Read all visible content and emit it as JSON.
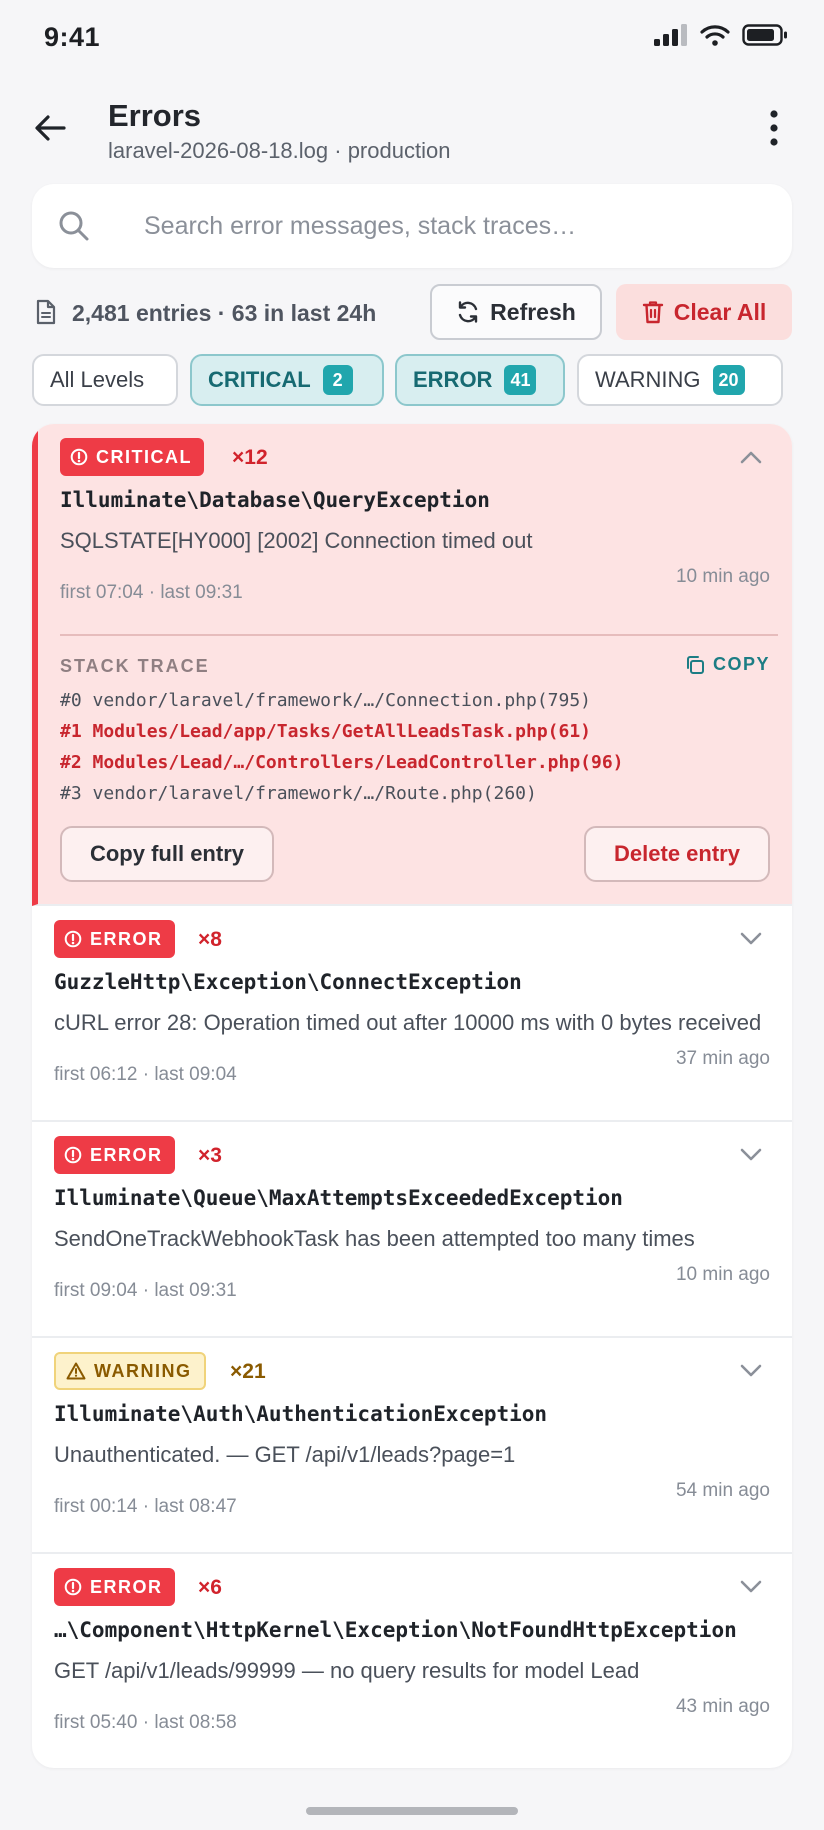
{
  "status_bar": {
    "time": "9:41"
  },
  "header": {
    "title": "Errors",
    "subtitle": "laravel-2026-08-18.log · production"
  },
  "search": {
    "placeholder": "Search error messages, stack traces…"
  },
  "toolbar": {
    "entries_text": "2,481 entries · 63 in last 24h",
    "refresh_label": "Refresh",
    "clear_label": "Clear All"
  },
  "filters": [
    {
      "label": "All Levels",
      "count": "",
      "active": false
    },
    {
      "label": "CRITICAL",
      "count": "2",
      "active": true
    },
    {
      "label": "ERROR",
      "count": "41",
      "active": true
    },
    {
      "label": "WARNING",
      "count": "20",
      "active": false
    }
  ],
  "entries": [
    {
      "level": "CRITICAL",
      "count": "×12",
      "exception": "Illuminate\\Database\\QueryException",
      "message": "SQLSTATE[HY000] [2002] Connection timed out",
      "first_last": "first 07:04  ·  last 09:31",
      "ago": "10 min ago",
      "expanded": true,
      "stack_label": "STACK TRACE",
      "copy_label": "COPY",
      "frames": [
        {
          "text": "#0 vendor/laravel/framework/…/Connection.php(795)",
          "highlight": false
        },
        {
          "text": "#1 Modules/Lead/app/Tasks/GetAllLeadsTask.php(61)",
          "highlight": true
        },
        {
          "text": "#2 Modules/Lead/…/Controllers/LeadController.php(96)",
          "highlight": true
        },
        {
          "text": "#3 vendor/laravel/framework/…/Route.php(260)",
          "highlight": false
        }
      ],
      "copy_full_label": "Copy full entry",
      "delete_label": "Delete entry"
    },
    {
      "level": "ERROR",
      "count": "×8",
      "exception": "GuzzleHttp\\Exception\\ConnectException",
      "message": "cURL error 28: Operation timed out after 10000 ms with 0 bytes received",
      "first_last": "first 06:12  ·  last 09:04",
      "ago": "37 min ago"
    },
    {
      "level": "ERROR",
      "count": "×3",
      "exception": "Illuminate\\Queue\\MaxAttemptsExceededException",
      "message": "SendOneTrackWebhookTask has been attempted too many times",
      "first_last": "first 09:04  ·  last 09:31",
      "ago": "10 min ago"
    },
    {
      "level": "WARNING",
      "count": "×21",
      "exception": "Illuminate\\Auth\\AuthenticationException",
      "message": "Unauthenticated. — GET /api/v1/leads?page=1",
      "first_last": "first 00:14  ·  last 08:47",
      "ago": "54 min ago"
    },
    {
      "level": "ERROR",
      "count": "×6",
      "exception": "…\\Component\\HttpKernel\\Exception\\NotFoundHttpException",
      "message": "GET /api/v1/leads/99999 — no query results for model Lead",
      "first_last": "first 05:40  ·  last 08:58",
      "ago": "43 min ago"
    }
  ],
  "colors": {
    "critical": "#ee3b46",
    "accent_teal": "#21a6ad",
    "warning_text": "#8a5a00",
    "expanded_bg": "#fde3e3"
  }
}
